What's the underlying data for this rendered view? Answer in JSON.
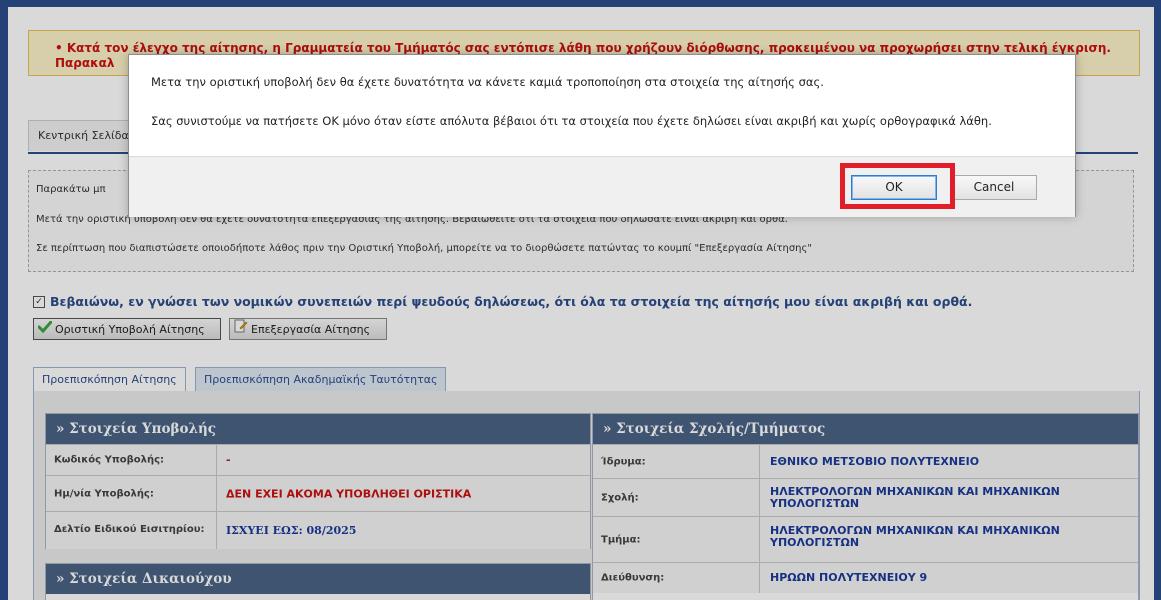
{
  "error": {
    "line1": "• Κατά τον έλεγχο της αίτησης, η Γραμματεία του Τμήματός σας εντόπισε λάθη που χρήζουν διόρθωσης, προκειμένου να προχωρήσει στην τελική έγκριση.",
    "line2": "Παρακαλ"
  },
  "nav": {
    "home_tab": "Κεντρική Σελίδα"
  },
  "info": {
    "line1": "Παρακάτω μπ",
    "line2": "Μετά την οριστική υποβολή δεν θα έχετε δυνατότητα επεξεργασίας της αίτησής. Βεβαιωθείτε ότι τα στοιχεία που δηλώσατε είναι ακριβή και ορθά.",
    "line3": "Σε περίπτωση που διαπιστώσετε οποιοδήποτε λάθος πριν την Οριστική Υποβολή, μπορείτε να το διορθώσετε πατώντας το κουμπί \"Επεξεργασία Αίτησης\""
  },
  "confirm": {
    "checkbox_mark": "✓",
    "text": "Βεβαιώνω, εν γνώσει των νομικών συνεπειών περί ψευδούς δηλώσεως, ότι όλα τα στοιχεία της αίτησής μου είναι ακριβή και ορθά."
  },
  "actions": {
    "submit_label": "Οριστική Υποβολή Αίτησης",
    "edit_label": "Επεξεργασία Αίτησης"
  },
  "subtabs": {
    "preview": "Προεπισκόπηση Αίτησης",
    "card_preview": "Προεπισκόπηση Ακαδημαϊκής Ταυτότητας"
  },
  "submission": {
    "title": "» Στοιχεία Υποβολής",
    "rows": [
      {
        "label": "Κωδικός Υποβολής:",
        "value": "-"
      },
      {
        "label": "Ημ/νία Υποβολής:",
        "value": "ΔΕΝ ΕΧΕΙ ΑΚΟΜΑ ΥΠΟΒΛΗΘΕΙ ΟΡΙΣΤΙΚΑ"
      },
      {
        "label": "Δελτίο Ειδικού Εισιτηρίου:",
        "value": "ΙΣΧΥΕΙ ΕΩΣ: 08/2025"
      }
    ]
  },
  "beneficiary": {
    "title": "» Στοιχεία Δικαιούχου"
  },
  "school": {
    "title": "» Στοιχεία Σχολής/Τμήματος",
    "rows": [
      {
        "label": "Ίδρυμα:",
        "value": "ΕΘΝΙΚΟ ΜΕΤΣΟΒΙΟ ΠΟΛΥΤΕΧΝΕΙΟ"
      },
      {
        "label": "Σχολή:",
        "value": "ΗΛΕΚΤΡΟΛΟΓΩΝ ΜΗΧΑΝΙΚΩΝ ΚΑΙ ΜΗΧΑΝΙΚΩΝ ΥΠΟΛΟΓΙΣΤΩΝ"
      },
      {
        "label": "Τμήμα:",
        "value": "ΗΛΕΚΤΡΟΛΟΓΩΝ ΜΗΧΑΝΙΚΩΝ ΚΑΙ ΜΗΧΑΝΙΚΩΝ ΥΠΟΛΟΓΙΣΤΩΝ"
      },
      {
        "label": "Διεύθυνση:",
        "value": "ΗΡΩΩΝ ΠΟΛΥΤΕΧΝΕΙΟΥ 9"
      }
    ]
  },
  "dialog": {
    "message1": "Μετα την οριστική υποβολή δεν θα έχετε δυνατότητα να κάνετε καμιά τροποποίηση στα στοιχεία της αίτησής σας.",
    "message2": "Σας συνιστούμε να πατήσετε ΟΚ μόνο όταν είστε απόλυτα βέβαιοι ότι τα στοιχεία που έχετε δηλώσει είναι ακριβή και χωρίς ορθογραφικά λάθη.",
    "ok_label": "OK",
    "cancel_label": "Cancel"
  },
  "colors": {
    "brand_blue": "#2b4e8c",
    "panel_header": "#4a6384",
    "error_red": "#cc1111",
    "highlight_red": "#e21d2a"
  }
}
